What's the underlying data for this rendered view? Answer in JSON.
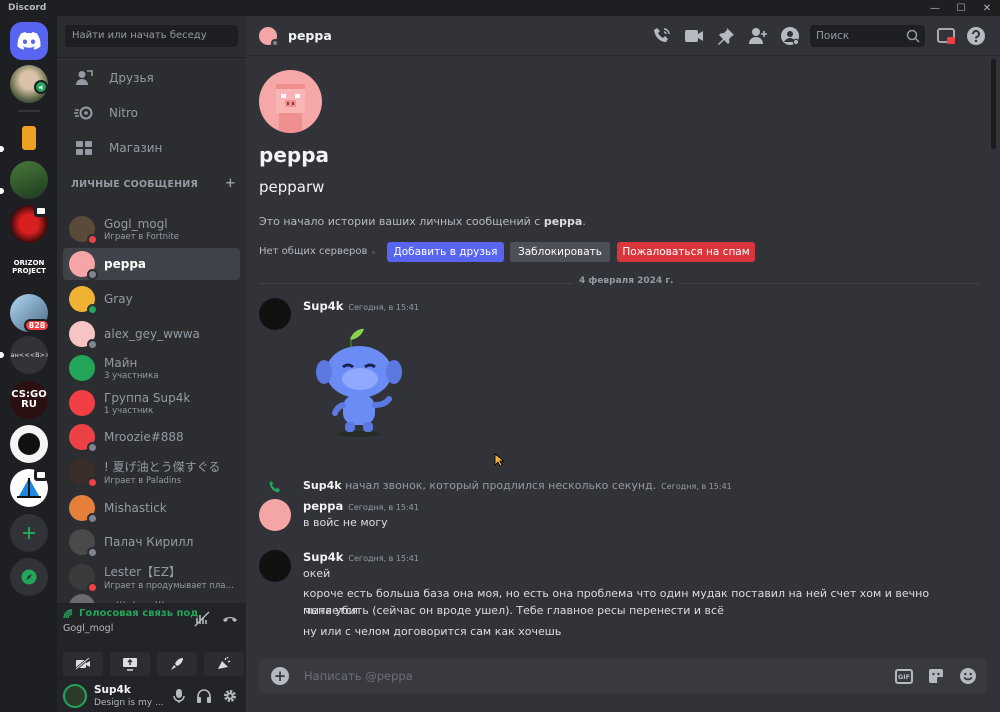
{
  "app": {
    "name": "Discord"
  },
  "window_controls": [
    "—",
    "☐",
    "✕"
  ],
  "guilds": {
    "badges": {
      "server_5": "828"
    },
    "server_text": {
      "server_4": "ORIZON PROJECT",
      "server_6": "план<<<В>>>",
      "server_7": "CS:GO RU"
    }
  },
  "sidebar": {
    "search": "Найти или начать беседу",
    "nav": [
      {
        "label": "Друзья",
        "icon": "friends-icon"
      },
      {
        "label": "Nitro",
        "icon": "nitro-icon"
      },
      {
        "label": "Магазин",
        "icon": "shop-icon"
      }
    ],
    "dm_header": "ЛИЧНЫЕ СООБЩЕНИЯ",
    "dm_add": "+",
    "dms": [
      {
        "name": "Gogl_mogl",
        "sub": "Играет в Fortnite",
        "color": "#5a4a3a",
        "status": "#f23f43"
      },
      {
        "name": "peppa",
        "sub": "",
        "color": "#f4a6a6",
        "status": "#80848e"
      },
      {
        "name": "Gray",
        "sub": "",
        "color": "#f0b232",
        "status": "#23a55a"
      },
      {
        "name": "alex_gey_wwwa",
        "sub": "",
        "color": "#f7c4c4",
        "status": "#80848e"
      },
      {
        "name": "Майн",
        "sub": "3 участника",
        "color": "#23a55a",
        "status": ""
      },
      {
        "name": "Группа Sup4k",
        "sub": "1 участник",
        "color": "#f23f43",
        "status": ""
      },
      {
        "name": "Mroozie#888",
        "sub": "",
        "color": "#ed4245",
        "status": "#80848e"
      },
      {
        "name": "! 夏げ油とう傑すぐる",
        "sub": "Играет в Paladins",
        "color": "#3a2e2a",
        "status": "#f23f43"
      },
      {
        "name": "Mishastick",
        "sub": "",
        "color": "#e67e3c",
        "status": "#80848e"
      },
      {
        "name": "Палач Кирилл",
        "sub": "",
        "color": "#4a4a4a",
        "status": "#80848e"
      },
      {
        "name": "Lester【EZ】",
        "sub": "Играет в продумывает план ...",
        "color": "#3b3b3b",
        "status": "#f23f43"
      },
      {
        "name": "miiichaelll",
        "sub": "",
        "color": "#6b6b6b",
        "status": ""
      }
    ],
    "voice": {
      "status": "Голосовая связь под",
      "channel": "Gogl_mogl"
    },
    "user": {
      "name": "Sup4k",
      "status": "Design is my ..."
    }
  },
  "header": {
    "title": "peppa",
    "search_placeholder": "Поиск"
  },
  "profile": {
    "display_name": "peppa",
    "username": "pepparw",
    "intro_prefix": "Это начало истории ваших личных сообщений с ",
    "intro_name": "peppa",
    "intro_suffix": ".",
    "mutual": "Нет общих серверов",
    "add_friend": "Добавить в друзья",
    "block": "Заблокировать",
    "report": "Пожаловаться на спам"
  },
  "date_divider": "4 февраля 2024 г.",
  "messages": [
    {
      "author": "Sup4k",
      "time": "Сегодня, в 15:41"
    },
    {
      "author": "Sup4k",
      "text": "начал звонок, который продлился несколько секунд.",
      "time": "Сегодня, в 15:41"
    },
    {
      "author": "peppa",
      "time": "Сегодня, в 15:41",
      "lines": [
        "в войс не могу"
      ]
    },
    {
      "author": "Sup4k",
      "time": "Сегодня, в 15:41",
      "lines": [
        "окей",
        "короче есть больша база она моя, но есть она проблема что один мудак поставил на ней счет хом и вечно пытается",
        "меня убить (сейчас он вроде ушел). Тебе главное ресы перенести и всё",
        "ну или с челом договорится сам как хочешь"
      ]
    }
  ],
  "composer": {
    "placeholder": "Написать @peppa",
    "gif": "GIF"
  },
  "colors": {
    "blurple": "#5865f2",
    "green": "#23a55a",
    "red": "#da373c",
    "gray_btn": "#4e5058"
  }
}
